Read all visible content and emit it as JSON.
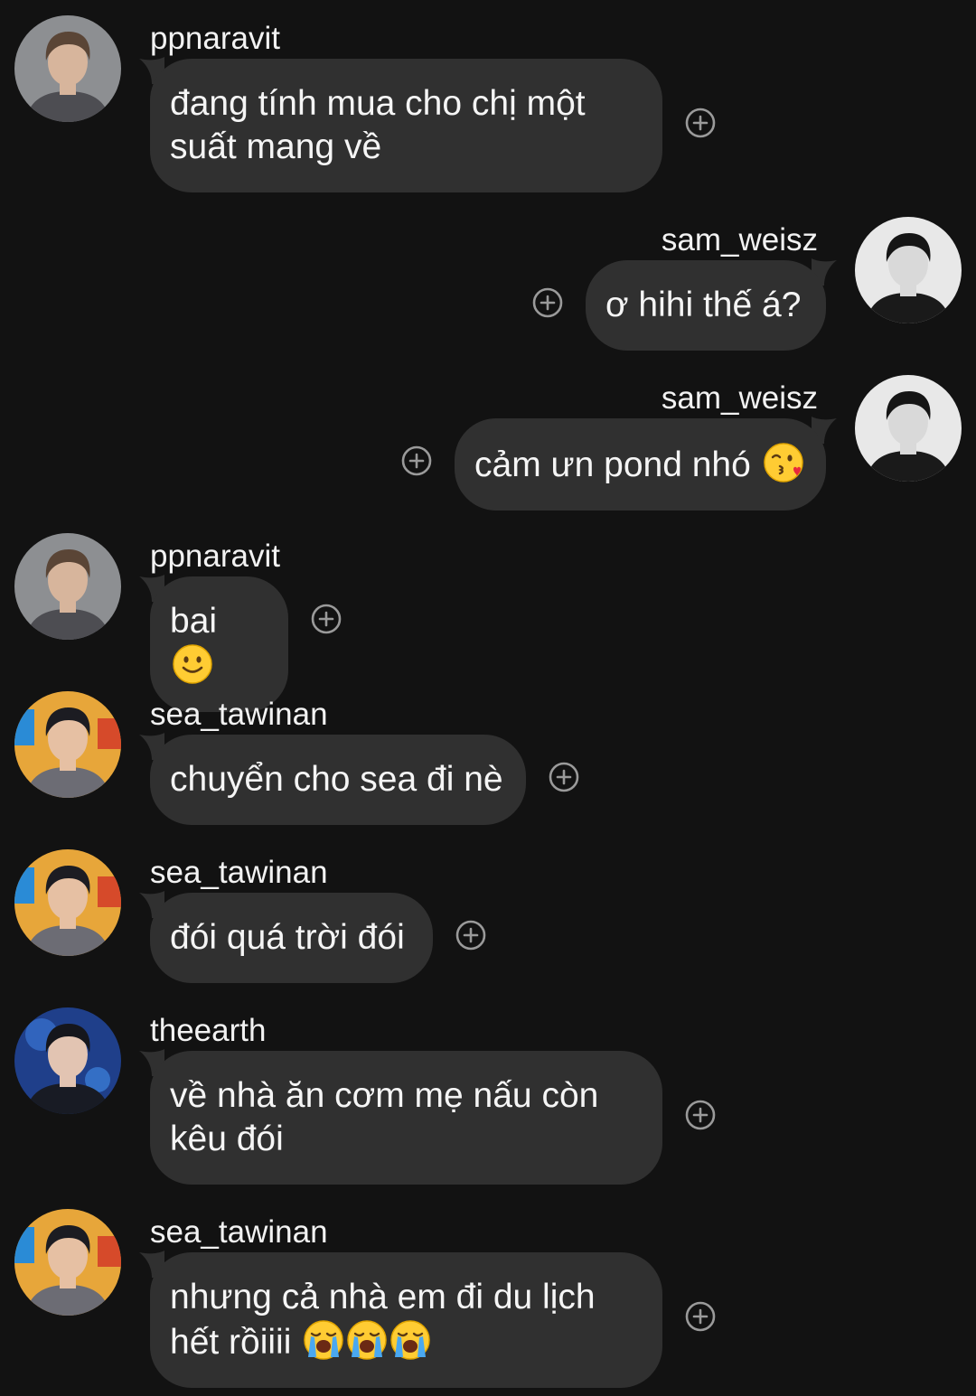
{
  "messages": [
    {
      "user": "ppnaravit",
      "text": "đang tính mua cho chị một suất mang về",
      "side": "left",
      "avatar": "ppnaravit-avatar",
      "emoji": []
    },
    {
      "user": "sam_weisz",
      "text": "ơ hihi thế á?",
      "side": "right",
      "avatar": "sam-weisz-avatar",
      "emoji": []
    },
    {
      "user": "sam_weisz",
      "text": "cảm ưn pond nhó",
      "side": "right",
      "avatar": "sam-weisz-avatar",
      "emoji": [
        "kiss-wink"
      ]
    },
    {
      "user": "ppnaravit",
      "text": "bai",
      "side": "left",
      "avatar": "ppnaravit-avatar",
      "emoji": [
        "slight-smile"
      ]
    },
    {
      "user": "sea_tawinan",
      "text": "chuyển cho sea đi nè",
      "side": "left",
      "avatar": "sea-tawinan-avatar",
      "emoji": []
    },
    {
      "user": "sea_tawinan",
      "text": "đói quá trời đói",
      "side": "left",
      "avatar": "sea-tawinan-avatar",
      "emoji": []
    },
    {
      "user": "theearth",
      "text": "về nhà ăn cơm mẹ nấu còn kêu đói",
      "side": "left",
      "avatar": "theearth-avatar",
      "emoji": []
    },
    {
      "user": "sea_tawinan",
      "text": "nhưng cả nhà em đi du lịch hết rồiiii",
      "side": "left",
      "avatar": "sea-tawinan-avatar",
      "emoji": [
        "loud-cry",
        "loud-cry",
        "loud-cry"
      ]
    }
  ],
  "icons": {
    "reaction": "add-reaction-icon"
  },
  "colors": {
    "background": "#121212",
    "bubble": "#303030",
    "text": "#f5f5f5",
    "reaction_icon": "#9a9a9a"
  }
}
